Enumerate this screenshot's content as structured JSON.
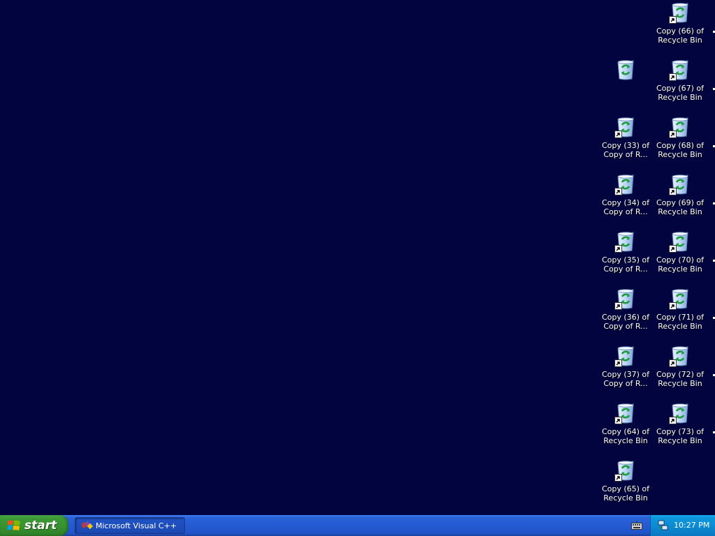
{
  "desktop": {
    "background_color": "#02043f",
    "icons_col1": [
      {
        "label_line1": "",
        "label_line2": "",
        "shortcut": false
      },
      {
        "label_line1": "Copy (33) of",
        "label_line2": "Copy of R...",
        "shortcut": true
      },
      {
        "label_line1": "Copy (34) of",
        "label_line2": "Copy of R...",
        "shortcut": true
      },
      {
        "label_line1": "Copy (35) of",
        "label_line2": "Copy of R...",
        "shortcut": true
      },
      {
        "label_line1": "Copy (36) of",
        "label_line2": "Copy of R...",
        "shortcut": true
      },
      {
        "label_line1": "Copy (37) of",
        "label_line2": "Copy of R...",
        "shortcut": true
      },
      {
        "label_line1": "Copy (64) of",
        "label_line2": "Recycle Bin",
        "shortcut": true
      },
      {
        "label_line1": "Copy (65) of",
        "label_line2": "Recycle Bin",
        "shortcut": true
      }
    ],
    "icons_col2": [
      {
        "label_line1": "Copy (66) of",
        "label_line2": "Recycle Bin",
        "shortcut": true
      },
      {
        "label_line1": "Copy (67) of",
        "label_line2": "Recycle Bin",
        "shortcut": true
      },
      {
        "label_line1": "Copy (68) of",
        "label_line2": "Recycle Bin",
        "shortcut": true
      },
      {
        "label_line1": "Copy (69) of",
        "label_line2": "Recycle Bin",
        "shortcut": true
      },
      {
        "label_line1": "Copy (70) of",
        "label_line2": "Recycle Bin",
        "shortcut": true
      },
      {
        "label_line1": "Copy (71) of",
        "label_line2": "Recycle Bin",
        "shortcut": true
      },
      {
        "label_line1": "Copy (72) of",
        "label_line2": "Recycle Bin",
        "shortcut": true
      },
      {
        "label_line1": "Copy (73) of",
        "label_line2": "Recycle Bin",
        "shortcut": true
      }
    ],
    "icon_name": "recycle-bin-icon"
  },
  "taskbar": {
    "start_label": "start",
    "task_label": "Microsoft Visual C++",
    "clock": "10:27 PM",
    "colors": {
      "taskbar": "#245ad4",
      "start": "#37922f",
      "tray": "#0b8ad2"
    }
  }
}
